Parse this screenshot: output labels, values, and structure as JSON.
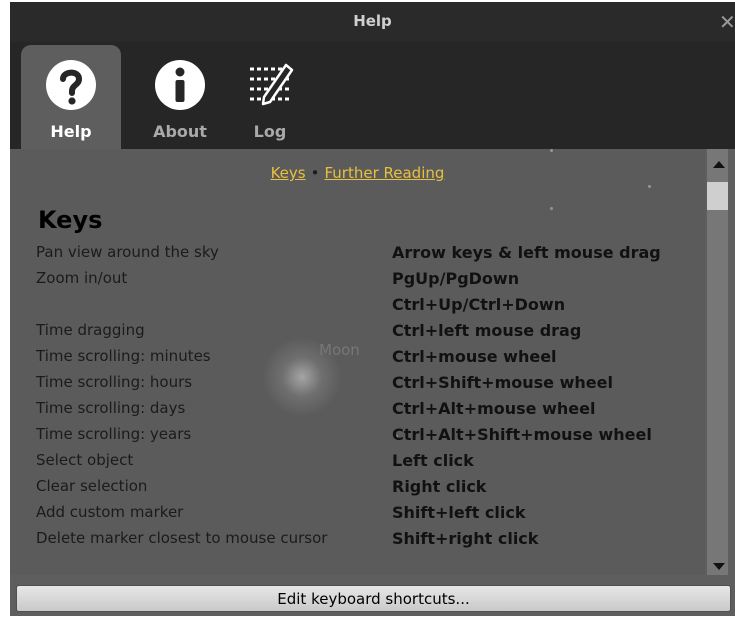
{
  "window": {
    "title": "Help",
    "close_icon": "close-icon"
  },
  "tabs": [
    {
      "label": "Help",
      "icon": "question-icon",
      "active": true
    },
    {
      "label": "About",
      "icon": "info-icon",
      "active": false
    },
    {
      "label": "Log",
      "icon": "log-icon",
      "active": false
    }
  ],
  "links": {
    "keys": "Keys",
    "separator": "•",
    "further_reading": "Further Reading"
  },
  "section": {
    "heading": "Keys"
  },
  "shortcuts": [
    {
      "desc": "Pan view around the sky",
      "key": "Arrow keys & left mouse drag"
    },
    {
      "desc": "Zoom in/out",
      "key": "PgUp/PgDown",
      "key2": "Ctrl+Up/Ctrl+Down"
    },
    {
      "desc": "Time dragging",
      "key": "Ctrl+left mouse drag"
    },
    {
      "desc": "Time scrolling: minutes",
      "key": "Ctrl+mouse wheel"
    },
    {
      "desc": "Time scrolling: hours",
      "key": "Ctrl+Shift+mouse wheel"
    },
    {
      "desc": "Time scrolling: days",
      "key": "Ctrl+Alt+mouse wheel"
    },
    {
      "desc": "Time scrolling: years",
      "key": "Ctrl+Alt+Shift+mouse wheel"
    },
    {
      "desc": "Select object",
      "key": "Left click"
    },
    {
      "desc": "Clear selection",
      "key": "Right click"
    },
    {
      "desc": "Add custom marker",
      "key": "Shift+left click"
    },
    {
      "desc": "Delete marker closest to mouse cursor",
      "key": "Shift+right click"
    }
  ],
  "background": {
    "moon_label": "Moon"
  },
  "footer": {
    "edit_button": "Edit keyboard shortcuts..."
  },
  "colors": {
    "link": "#e8c040",
    "tabbar": "#262626",
    "panel": "#5e5e5e"
  }
}
